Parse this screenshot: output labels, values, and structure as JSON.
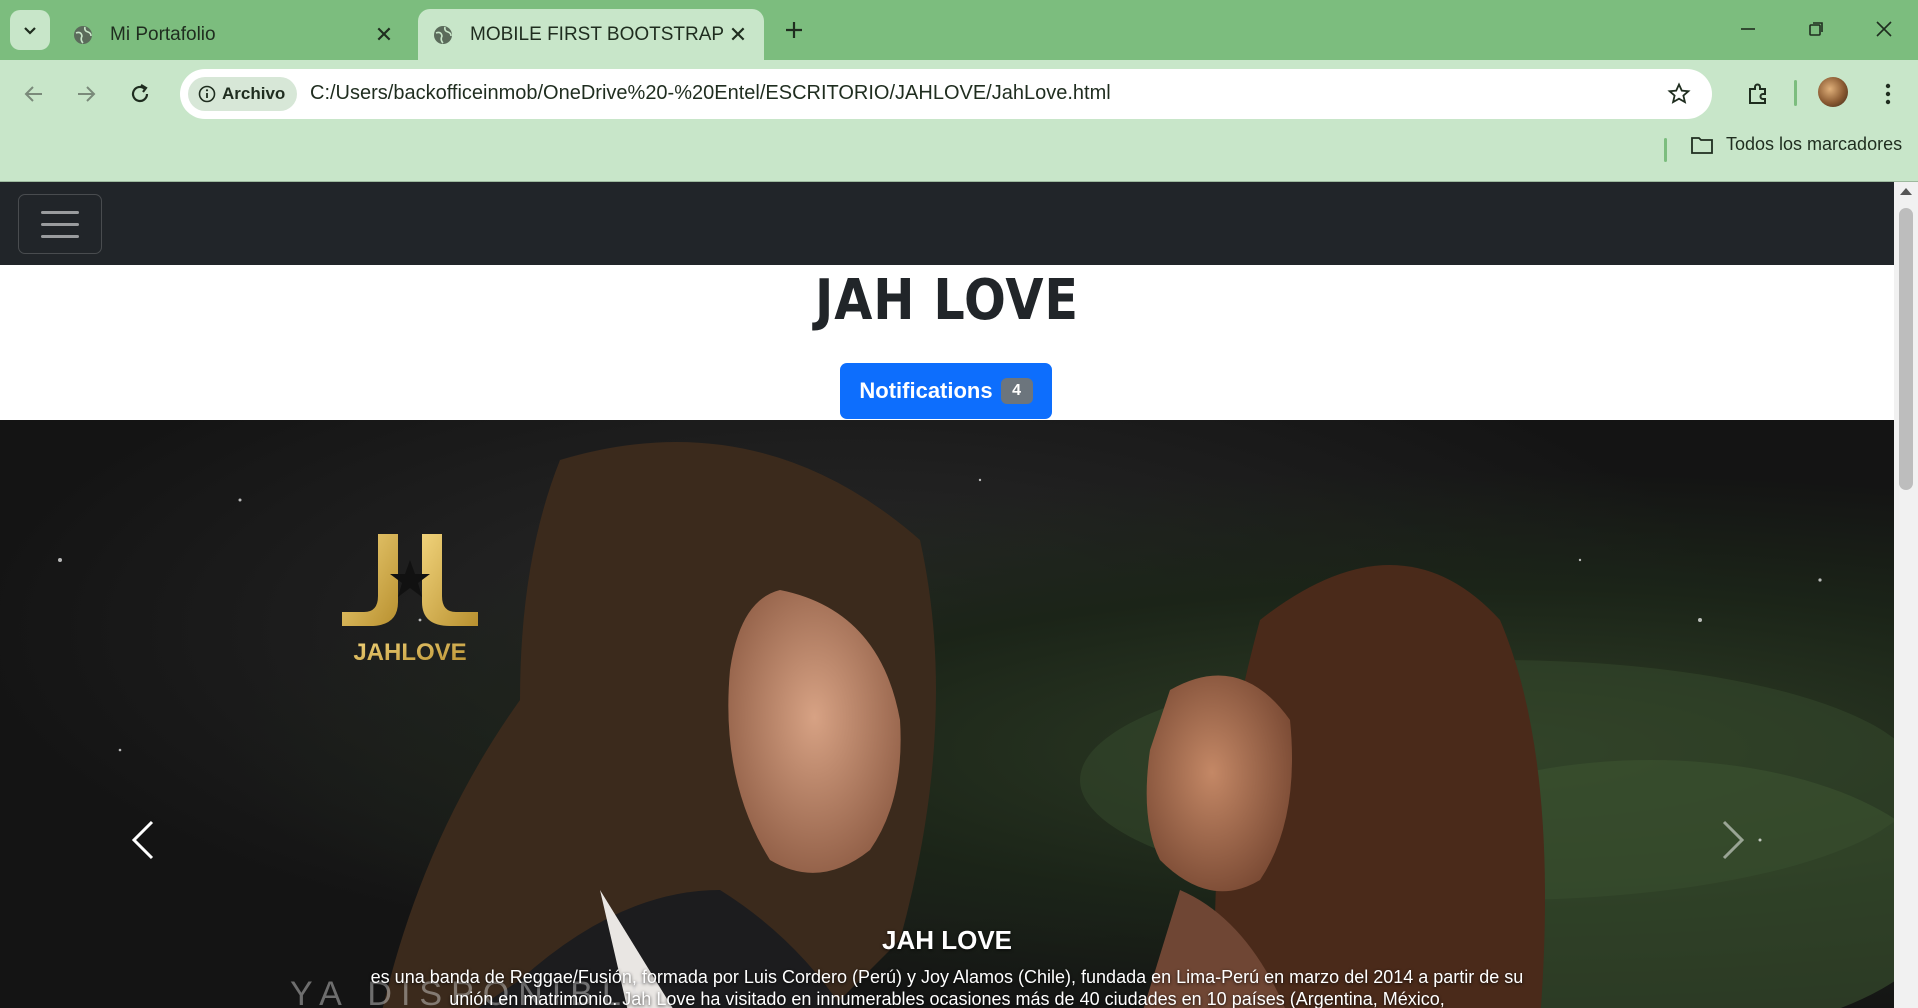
{
  "browser": {
    "tabs": [
      {
        "title": "Mi Portafolio",
        "active": false
      },
      {
        "title": "MOBILE FIRST BOOTSTRAP",
        "active": true
      }
    ],
    "address": {
      "chip_label": "Archivo",
      "url": "C:/Users/backofficeinmob/OneDrive%20-%20Entel/ESCRITORIO/JAHLOVE/JahLove.html"
    },
    "bookmarks_label": "Todos los marcadores",
    "colors": {
      "frame": "#7cbd7e",
      "toolbar": "#c8e6c9"
    }
  },
  "page": {
    "heading": "JAH LOVE",
    "notifications": {
      "label": "Notifications",
      "count": "4"
    },
    "carousel": {
      "logo_text": "JAHLOVE",
      "caption_title": "JAH LOVE",
      "caption_text": "es una banda de Reggae/Fusión, formada por Luis Cordero (Perú) y Joy Alamos (Chile), fundada en Lima-Perú en marzo del 2014 a partir de su unión en matrimonio. Jah Love ha visitado en innumerables ocasiones más de 40 ciudades en 10 países (Argentina, México,",
      "overlay_text": "YA DISPONIBLE"
    },
    "colors": {
      "navbar": "#212529",
      "primary": "#0d6efd",
      "badge": "#6c757d"
    }
  }
}
